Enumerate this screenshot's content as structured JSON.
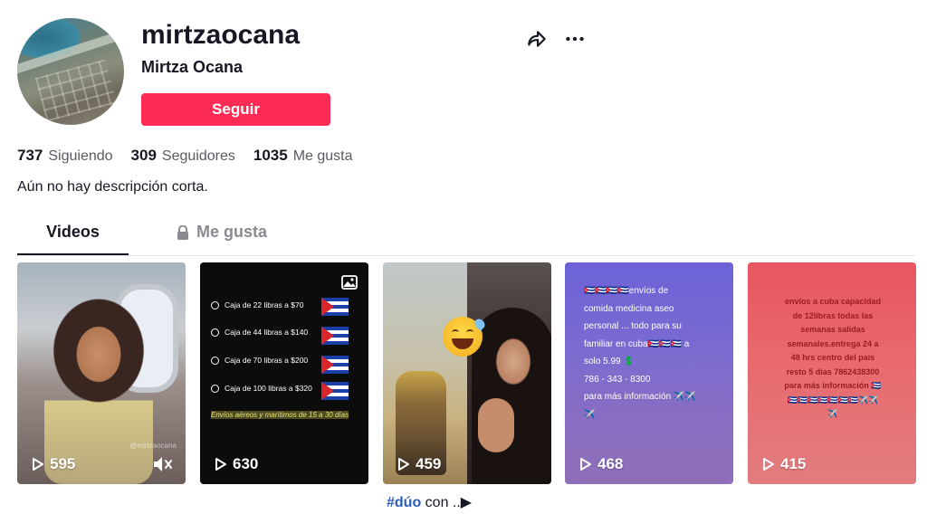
{
  "profile": {
    "username": "mirtzaocana",
    "nickname": "Mirtza Ocana",
    "follow_label": "Seguir",
    "bio": "Aún no hay descripción corta."
  },
  "stats": [
    {
      "value": "737",
      "label": "Siguiendo"
    },
    {
      "value": "309",
      "label": "Seguidores"
    },
    {
      "value": "1035",
      "label": "Me gusta"
    }
  ],
  "tabs": {
    "videos": "Videos",
    "likes": "Me gusta"
  },
  "icons": {
    "share": "share-icon",
    "more": "more-icon",
    "lock": "lock-icon",
    "play": "play-icon",
    "mute": "mute-icon",
    "photo": "photo-icon"
  },
  "videos": [
    {
      "views": "595",
      "watermark": "@mirtzaocana"
    },
    {
      "views": "630",
      "prices": [
        "Caja de 22 libras a $70",
        "Caja de 44 libras a $140",
        "Caja de 70 libras a $200",
        "Caja de 100 libras a $320"
      ],
      "note": "Envíos aéreos y marítimos de 15 a 30 días"
    },
    {
      "views": "459",
      "caption_tag": "#dúo",
      "caption_rest": "con ..▶"
    },
    {
      "views": "468",
      "text": "🇨🇺🇨🇺🇨🇺🇨🇺envíos de\ncomida medicina aseo\npersonal  ... todo para su\nfamiliar en cuba🇨🇺🇨🇺🇨🇺 a\nsolo 5.99 💲\n     786 - 343 - 8300\npara más información ✈️✈️\n✈️"
    },
    {
      "views": "415",
      "text": "envíos a cuba capacidad\nde 12libras todas las\nsemanas salidas\nsemanales.entrega 24 a\n48 hrs centro del pais\nresto 5 días 7862438300\npara más información 🇨🇺\n🇨🇺🇨🇺🇨🇺🇨🇺🇨🇺🇨🇺🇨🇺✈️✈️\n✈️"
    }
  ],
  "colors": {
    "accent": "#fe2c55",
    "text": "#161823",
    "muted": "#8a8b91",
    "hashtag": "#2b5db9"
  }
}
